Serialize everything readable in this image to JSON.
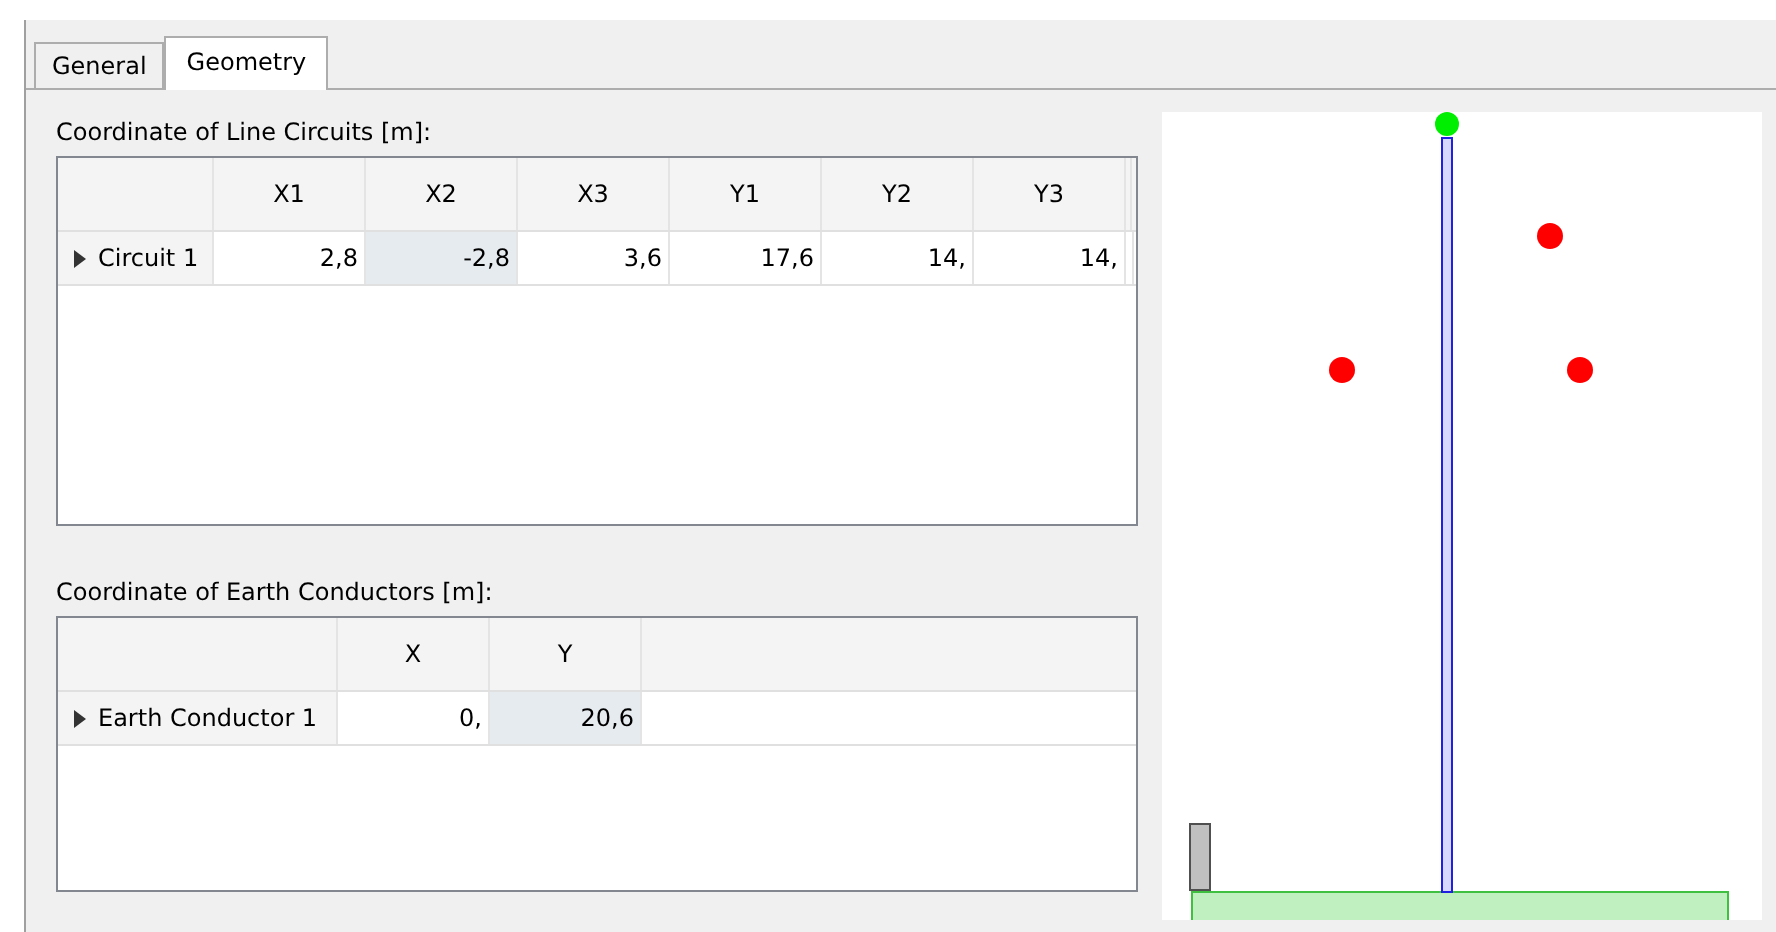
{
  "tabs": [
    {
      "label": "General",
      "selected": false
    },
    {
      "label": "Geometry",
      "selected": true
    }
  ],
  "circuits": {
    "title": "Coordinate of Line Circuits [m]:",
    "columns": [
      "X1",
      "X2",
      "X3",
      "Y1",
      "Y2",
      "Y3"
    ],
    "rows": [
      {
        "label": "Circuit 1",
        "cells": [
          {
            "value": "2,8",
            "selected": false
          },
          {
            "value": "-2,8",
            "selected": true
          },
          {
            "value": "3,6",
            "selected": false
          },
          {
            "value": "17,6",
            "selected": false
          },
          {
            "value": "14,",
            "selected": false
          },
          {
            "value": "14,",
            "selected": false
          }
        ]
      }
    ]
  },
  "earth": {
    "title": "Coordinate of Earth Conductors [m]:",
    "columns": [
      "X",
      "Y"
    ],
    "rows": [
      {
        "label": "Earth Conductor 1",
        "cells": [
          {
            "value": "0,",
            "selected": false
          },
          {
            "value": "20,6",
            "selected": true
          }
        ]
      }
    ]
  }
}
